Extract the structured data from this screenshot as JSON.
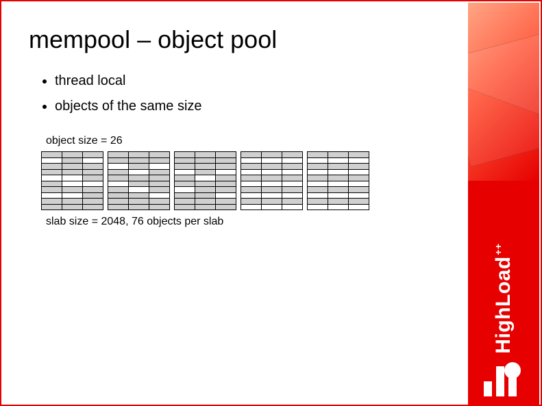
{
  "title": "mempool – object pool",
  "bullets": [
    "thread local",
    "objects of the same size"
  ],
  "object_size_label": "object size = 26",
  "slab_label": "slab size = 2048, 76 objects per slab",
  "logo_text": "HighLoad",
  "logo_suffix": "++",
  "chart_data": {
    "type": "table",
    "title": "Slab allocation visualization",
    "slab_count": 5,
    "rows_per_slab": 10,
    "cols_per_slab": 3,
    "object_size": 26,
    "slab_size": 2048,
    "objects_per_slab": 76,
    "slabs": [
      [
        [
          1,
          1,
          1
        ],
        [
          0,
          1,
          0
        ],
        [
          1,
          1,
          1
        ],
        [
          1,
          1,
          1
        ],
        [
          0,
          0,
          1
        ],
        [
          1,
          0,
          0
        ],
        [
          1,
          1,
          1
        ],
        [
          0,
          0,
          1
        ],
        [
          1,
          1,
          1
        ],
        [
          1,
          1,
          1
        ]
      ],
      [
        [
          1,
          1,
          1
        ],
        [
          1,
          1,
          1
        ],
        [
          0,
          1,
          0
        ],
        [
          1,
          0,
          1
        ],
        [
          1,
          1,
          1
        ],
        [
          0,
          1,
          1
        ],
        [
          1,
          0,
          1
        ],
        [
          1,
          1,
          0
        ],
        [
          1,
          1,
          1
        ],
        [
          1,
          1,
          1
        ]
      ],
      [
        [
          1,
          1,
          1
        ],
        [
          1,
          1,
          1
        ],
        [
          1,
          1,
          1
        ],
        [
          0,
          1,
          0
        ],
        [
          1,
          0,
          1
        ],
        [
          1,
          1,
          1
        ],
        [
          0,
          1,
          1
        ],
        [
          1,
          1,
          0
        ],
        [
          1,
          1,
          1
        ],
        [
          1,
          1,
          1
        ]
      ],
      [
        [
          1,
          1,
          1
        ],
        [
          0,
          0,
          0
        ],
        [
          1,
          1,
          1
        ],
        [
          0,
          0,
          0
        ],
        [
          1,
          1,
          1
        ],
        [
          0,
          0,
          0
        ],
        [
          1,
          1,
          1
        ],
        [
          0,
          0,
          0
        ],
        [
          1,
          1,
          1
        ],
        [
          0,
          0,
          0
        ]
      ],
      [
        [
          1,
          1,
          1
        ],
        [
          0,
          0,
          0
        ],
        [
          1,
          1,
          1
        ],
        [
          0,
          0,
          0
        ],
        [
          1,
          1,
          1
        ],
        [
          0,
          0,
          0
        ],
        [
          1,
          1,
          1
        ],
        [
          0,
          0,
          0
        ],
        [
          1,
          1,
          1
        ],
        [
          0,
          0,
          0
        ]
      ]
    ]
  }
}
